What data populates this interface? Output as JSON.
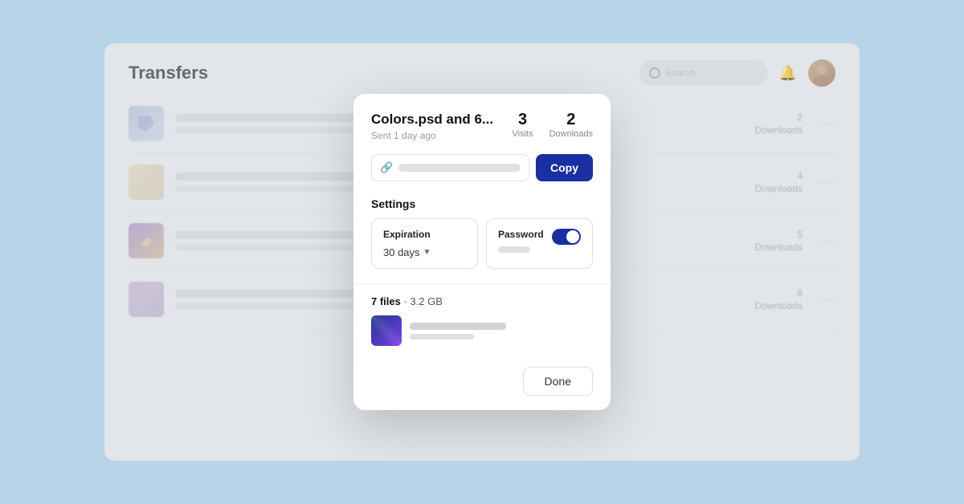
{
  "app": {
    "title": "Transfers",
    "search_placeholder": "Search"
  },
  "modal": {
    "title": "Colors.psd and 6...",
    "subtitle": "Sent 1 day ago",
    "stats": {
      "visits_count": "3",
      "visits_label": "Visits",
      "downloads_count": "2",
      "downloads_label": "Downloads"
    },
    "copy_button": "Copy",
    "settings_label": "Settings",
    "expiration_label": "Expiration",
    "expiration_value": "30 days",
    "password_label": "Password",
    "files_count": "7 files",
    "files_size": "3.2 GB",
    "done_button": "Done"
  },
  "rows": [
    {
      "downloads": "2",
      "downloads_label": "Downloads"
    },
    {
      "downloads": "4",
      "downloads_label": "Downloads"
    },
    {
      "downloads": "5",
      "downloads_label": "Downloads"
    },
    {
      "downloads": "8",
      "downloads_label": "Downloads"
    }
  ]
}
